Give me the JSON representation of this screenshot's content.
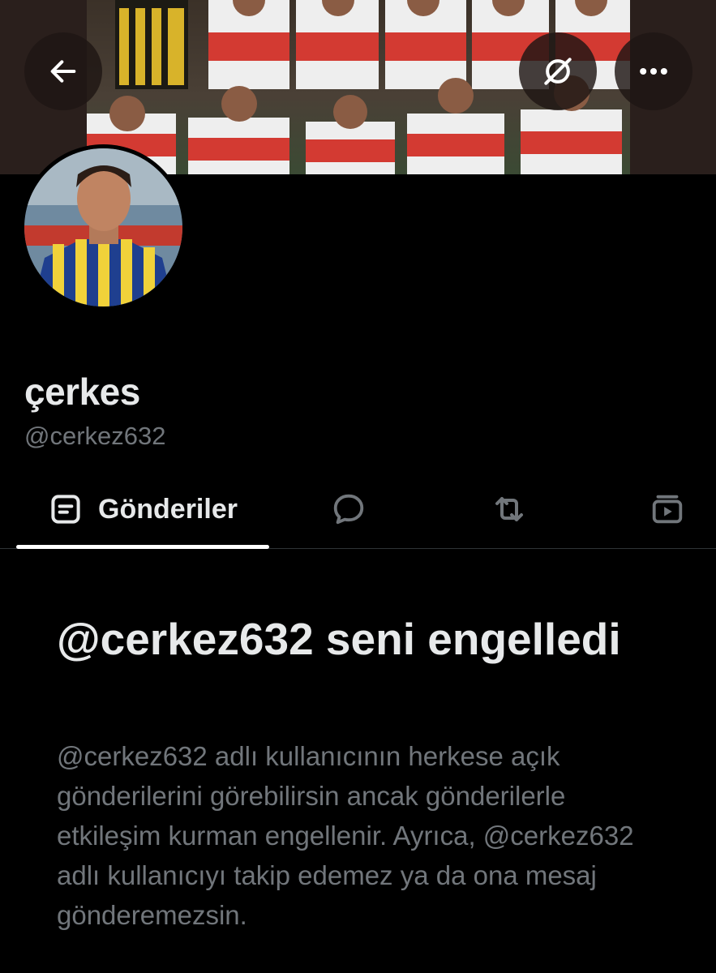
{
  "header": {
    "back_icon": "arrow-left-icon",
    "grok_icon": "grok-icon",
    "more_icon": "more-horizontal-icon"
  },
  "profile": {
    "display_name": "çerkes",
    "handle": "@cerkez632"
  },
  "tabs": [
    {
      "label": "Gönderiler",
      "icon": "posts-icon",
      "selected": true
    },
    {
      "label": "",
      "icon": "reply-bubble-icon",
      "selected": false
    },
    {
      "label": "",
      "icon": "repost-icon",
      "selected": false
    },
    {
      "label": "",
      "icon": "media-play-icon",
      "selected": false
    }
  ],
  "blocked": {
    "title": "@cerkez632 seni engelledi",
    "body": "@cerkez632 adlı kullanıcının herkese açık gönderilerini görebilirsin ancak gönderilerle etkileşim kurman engellenir. Ayrıca, @cerkez632 adlı kullanıcıyı takip edemez ya da ona mesaj gönderemezsin."
  },
  "colors": {
    "background": "#000000",
    "primary_text": "#e7e9ea",
    "secondary_text": "#71767b",
    "divider": "#2f3336"
  }
}
